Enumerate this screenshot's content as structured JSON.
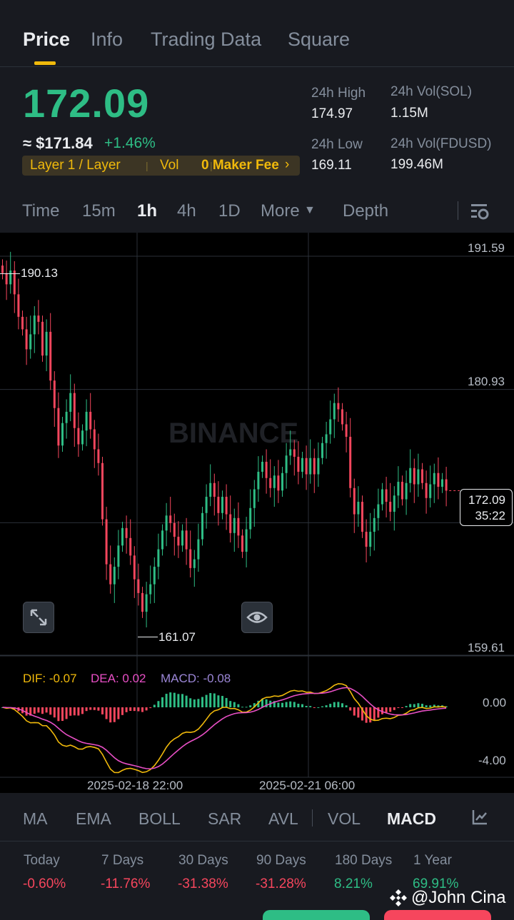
{
  "tabs": [
    {
      "label": "Price",
      "active": true
    },
    {
      "label": "Info",
      "active": false
    },
    {
      "label": "Trading Data",
      "active": false
    },
    {
      "label": "Square",
      "active": false
    }
  ],
  "price": {
    "last": "172.09",
    "usd": "≈ $171.84",
    "change": "+1.46%"
  },
  "tags": {
    "category": "Layer 1 / Layer",
    "vol": "Vol",
    "fee": "0 Maker Fee"
  },
  "stats": {
    "high_label": "24h High",
    "high_value": "174.97",
    "low_label": "24h Low",
    "low_value": "169.11",
    "vol_base_label": "24h Vol(SOL)",
    "vol_base_value": "1.15M",
    "vol_quote_label": "24h Vol(FDUSD)",
    "vol_quote_value": "199.46M"
  },
  "intervals": [
    {
      "label": "Time",
      "active": false
    },
    {
      "label": "15m",
      "active": false
    },
    {
      "label": "1h",
      "active": true
    },
    {
      "label": "4h",
      "active": false
    },
    {
      "label": "1D",
      "active": false
    },
    {
      "label": "More",
      "active": false
    },
    {
      "label": "Depth",
      "active": false
    }
  ],
  "chart": {
    "price_axis": [
      "191.59",
      "180.93",
      "159.61"
    ],
    "high_marker": "190.13",
    "low_marker": "161.07",
    "current_price": "172.09",
    "countdown": "35:22",
    "watermark": "BINANCE",
    "macd_axis": [
      "0.00",
      "-4.00"
    ],
    "time_axis": [
      "2025-02-18 22:00",
      "2025-02-21 06:00"
    ],
    "macd_legend": {
      "dif": "DIF: -0.07",
      "dea": "DEA: 0.02",
      "macd": "MACD: -0.08"
    },
    "colors": {
      "up": "#2ebd85",
      "down": "#f6465d",
      "dif": "#f0b90b",
      "dea": "#e84fc5",
      "macd": "#9b86d6"
    }
  },
  "chart_data": {
    "type": "candlestick",
    "interval": "1h",
    "ylim": [
      159.61,
      191.59
    ],
    "y_ticks": [
      191.59,
      180.93,
      159.61
    ],
    "high": 190.13,
    "low": 161.07,
    "last": 172.09,
    "closes": [
      189.5,
      188.6,
      189.7,
      187.8,
      186.0,
      185.0,
      183.4,
      184.6,
      186.1,
      185.6,
      182.9,
      184.8,
      180.9,
      178.7,
      175.7,
      177.5,
      178.4,
      179.9,
      177.1,
      175.8,
      176.9,
      178.4,
      177.0,
      175.4,
      174.3,
      169.8,
      166.2,
      164.6,
      166.0,
      167.7,
      169.1,
      168.3,
      166.9,
      165.0,
      163.9,
      162.4,
      163.8,
      164.6,
      166.0,
      167.4,
      168.9,
      170.1,
      169.5,
      168.4,
      167.7,
      168.9,
      167.4,
      165.9,
      166.6,
      168.2,
      170.3,
      171.6,
      172.7,
      171.6,
      170.3,
      171.6,
      170.2,
      168.7,
      169.9,
      168.5,
      167.2,
      169.0,
      170.7,
      172.2,
      173.6,
      174.4,
      173.1,
      172.3,
      173.3,
      172.1,
      173.5,
      174.9,
      175.4,
      174.8,
      173.6,
      174.7,
      173.4,
      174.7,
      173.4,
      174.7,
      175.9,
      176.6,
      177.8,
      179.1,
      178.6,
      177.4,
      176.4,
      172.3,
      170.2,
      171.2,
      168.8,
      167.6,
      168.8,
      169.9,
      171.0,
      172.2,
      171.2,
      170.4,
      171.7,
      172.8,
      171.4,
      172.7,
      173.9,
      172.6,
      173.8,
      172.7,
      171.5,
      172.6,
      173.5,
      172.4,
      173.0,
      172.09
    ],
    "macd": {
      "dif": -0.07,
      "dea": 0.02,
      "macd": -0.08,
      "ylim": [
        -4.5,
        0.7
      ]
    }
  },
  "indicators": [
    {
      "label": "MA",
      "active": false
    },
    {
      "label": "EMA",
      "active": false
    },
    {
      "label": "BOLL",
      "active": false
    },
    {
      "label": "SAR",
      "active": false
    },
    {
      "label": "AVL",
      "active": false
    },
    {
      "label": "VOL",
      "active": false
    },
    {
      "label": "MACD",
      "active": true
    }
  ],
  "periods": [
    {
      "label": "Today",
      "value": "-0.60%",
      "trend": "down"
    },
    {
      "label": "7 Days",
      "value": "-11.76%",
      "trend": "down"
    },
    {
      "label": "30 Days",
      "value": "-31.38%",
      "trend": "down"
    },
    {
      "label": "90 Days",
      "value": "-31.28%",
      "trend": "down"
    },
    {
      "label": "180 Days",
      "value": "8.21%",
      "trend": "up"
    },
    {
      "label": "1 Year",
      "value": "69.91%",
      "trend": "up"
    }
  ],
  "watermark_user": "@John Cina"
}
